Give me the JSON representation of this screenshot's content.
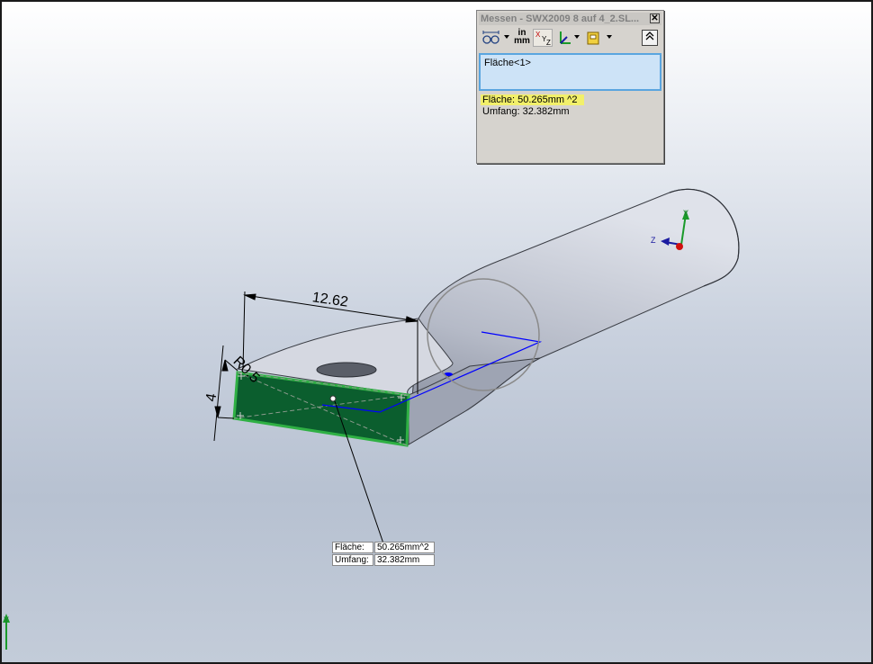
{
  "measure_dialog": {
    "title": "Messen - SWX2009 8 auf 4_2.SL...",
    "close_glyph": "✕",
    "toolbar": {
      "units_label_top": "in",
      "units_label_bottom": "mm",
      "icons": [
        "arc-circle-measure-icon",
        "units-icon",
        "xyz-icon",
        "axis-icon",
        "history-icon",
        "collapse-icon"
      ]
    },
    "selection_item": "Fläche<1>",
    "results": {
      "area": "Fläche:  50.265mm ^2",
      "perimeter": "Umfang: 32.382mm"
    }
  },
  "model": {
    "dimension_width": "12.62",
    "dimension_height": "4",
    "dimension_radius": "R0.5"
  },
  "callout": {
    "area_label": "Fläche:",
    "area_value": "50.265mm^2",
    "perimeter_label": "Umfang:",
    "perimeter_value": "32.382mm"
  },
  "colors": {
    "selected_face": "#0b5e2e",
    "selected_edge": "#2fb044",
    "highlight": "#f2f06a",
    "measure_line": "#0000ff"
  }
}
